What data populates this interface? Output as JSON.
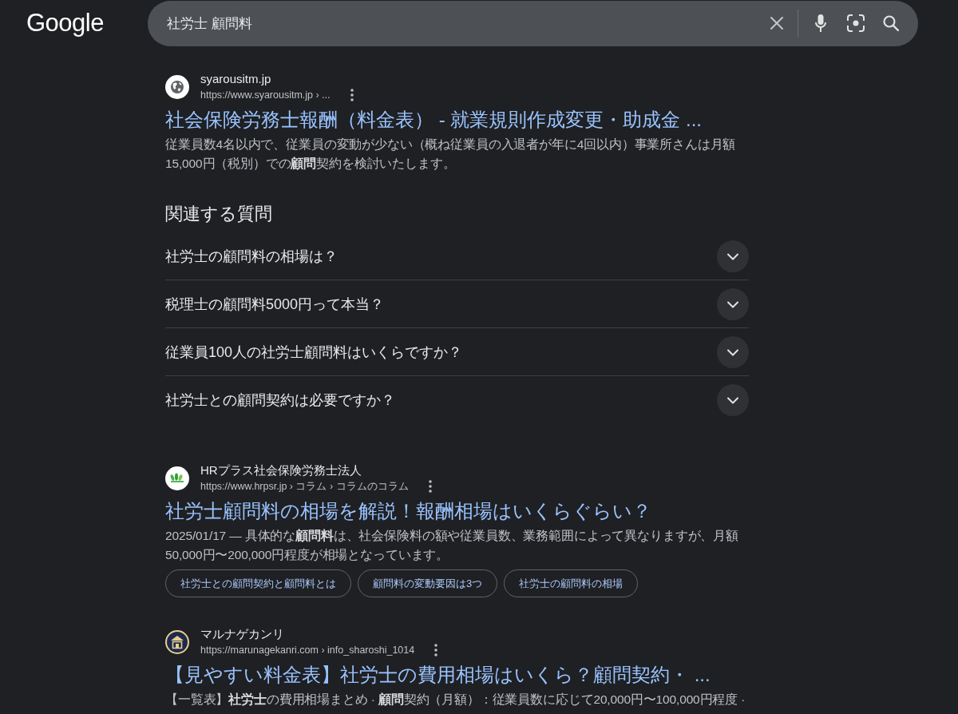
{
  "header": {
    "logo": "Google",
    "search": {
      "value": "社労士 顧問料"
    }
  },
  "blocks": [
    {
      "kind": "result",
      "site_name": "syarousitm.jp",
      "url": "https://www.syarousitm.jp › ...",
      "title": "社会保険労務士報酬（料金表） - 就業規則作成変更・助成金 ...",
      "snippet": "従業員数4名以内で、従業員の変動が少ない（概ね従業員の入退者が年に4回以内）事業所さんは月額15,000円（税別）での**顧問**契約を検討いたします。"
    },
    {
      "kind": "related_questions",
      "title": "関連する質問",
      "questions": [
        {
          "text": "社労士の顧問料の相場は？",
          "expanded": false
        },
        {
          "text": "税理士の顧問料5000円って本当？",
          "expanded": false
        },
        {
          "text": "従業員100人の社労士顧問料はいくらですか？",
          "expanded": false
        },
        {
          "text": "社労士との顧問契約は必要ですか？",
          "expanded": false
        }
      ]
    },
    {
      "kind": "result",
      "site_name": "HRプラス社会保険労務士法人",
      "url": "https://www.hrpsr.jp › コラム › コラムのコラム",
      "title": "社労士顧問料の相場を解説！報酬相場はいくらぐらい？",
      "snippet": "2025/01/17 — 具体的な**顧問料**は、社会保険料の額や従業員数、業務範囲によって異なりますが、月額50,000円〜200,000円程度が相場となっています。",
      "chips": [
        "社労士との顧問契約と顧問料とは",
        "顧問料の変動要因は3つ",
        "社労士の顧問料の相場"
      ]
    },
    {
      "kind": "result",
      "site_name": "マルナゲカンリ",
      "url": "https://marunagekanri.com › info_sharoshi_1014",
      "title": "【見やすい料金表】社労士の費用相場はいくら？顧問契約・ ...",
      "snippet": "【一覧表】**社労士**の費用相場まとめ · **顧問**契約（月額）：従業員数に応じて20,000円〜100,000円程度 ·"
    }
  ]
}
